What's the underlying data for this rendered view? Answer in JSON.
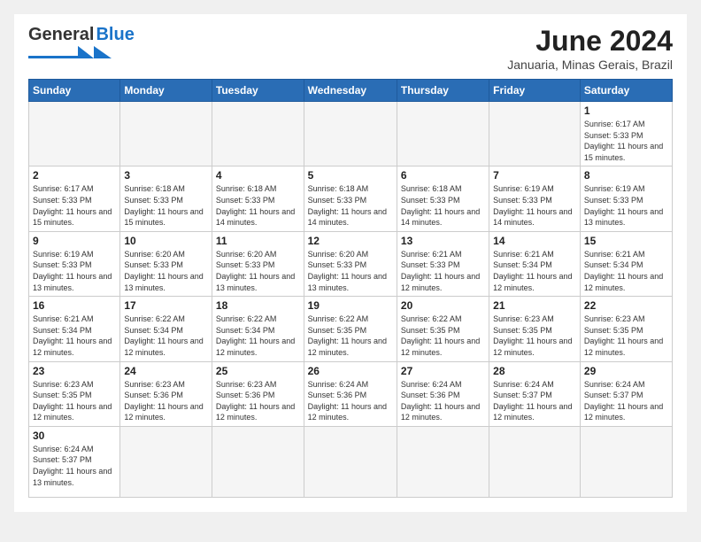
{
  "header": {
    "logo_general": "General",
    "logo_blue": "Blue",
    "month_title": "June 2024",
    "subtitle": "Januaria, Minas Gerais, Brazil"
  },
  "weekdays": [
    "Sunday",
    "Monday",
    "Tuesday",
    "Wednesday",
    "Thursday",
    "Friday",
    "Saturday"
  ],
  "weeks": [
    [
      {
        "day": "",
        "empty": true
      },
      {
        "day": "",
        "empty": true
      },
      {
        "day": "",
        "empty": true
      },
      {
        "day": "",
        "empty": true
      },
      {
        "day": "",
        "empty": true
      },
      {
        "day": "",
        "empty": true
      },
      {
        "day": "1",
        "sunrise": "Sunrise: 6:17 AM",
        "sunset": "Sunset: 5:33 PM",
        "daylight": "Daylight: 11 hours and 15 minutes."
      }
    ],
    [
      {
        "day": "2",
        "sunrise": "Sunrise: 6:17 AM",
        "sunset": "Sunset: 5:33 PM",
        "daylight": "Daylight: 11 hours and 15 minutes."
      },
      {
        "day": "3",
        "sunrise": "Sunrise: 6:18 AM",
        "sunset": "Sunset: 5:33 PM",
        "daylight": "Daylight: 11 hours and 15 minutes."
      },
      {
        "day": "4",
        "sunrise": "Sunrise: 6:18 AM",
        "sunset": "Sunset: 5:33 PM",
        "daylight": "Daylight: 11 hours and 14 minutes."
      },
      {
        "day": "5",
        "sunrise": "Sunrise: 6:18 AM",
        "sunset": "Sunset: 5:33 PM",
        "daylight": "Daylight: 11 hours and 14 minutes."
      },
      {
        "day": "6",
        "sunrise": "Sunrise: 6:18 AM",
        "sunset": "Sunset: 5:33 PM",
        "daylight": "Daylight: 11 hours and 14 minutes."
      },
      {
        "day": "7",
        "sunrise": "Sunrise: 6:19 AM",
        "sunset": "Sunset: 5:33 PM",
        "daylight": "Daylight: 11 hours and 14 minutes."
      },
      {
        "day": "8",
        "sunrise": "Sunrise: 6:19 AM",
        "sunset": "Sunset: 5:33 PM",
        "daylight": "Daylight: 11 hours and 13 minutes."
      }
    ],
    [
      {
        "day": "9",
        "sunrise": "Sunrise: 6:19 AM",
        "sunset": "Sunset: 5:33 PM",
        "daylight": "Daylight: 11 hours and 13 minutes."
      },
      {
        "day": "10",
        "sunrise": "Sunrise: 6:20 AM",
        "sunset": "Sunset: 5:33 PM",
        "daylight": "Daylight: 11 hours and 13 minutes."
      },
      {
        "day": "11",
        "sunrise": "Sunrise: 6:20 AM",
        "sunset": "Sunset: 5:33 PM",
        "daylight": "Daylight: 11 hours and 13 minutes."
      },
      {
        "day": "12",
        "sunrise": "Sunrise: 6:20 AM",
        "sunset": "Sunset: 5:33 PM",
        "daylight": "Daylight: 11 hours and 13 minutes."
      },
      {
        "day": "13",
        "sunrise": "Sunrise: 6:21 AM",
        "sunset": "Sunset: 5:33 PM",
        "daylight": "Daylight: 11 hours and 12 minutes."
      },
      {
        "day": "14",
        "sunrise": "Sunrise: 6:21 AM",
        "sunset": "Sunset: 5:34 PM",
        "daylight": "Daylight: 11 hours and 12 minutes."
      },
      {
        "day": "15",
        "sunrise": "Sunrise: 6:21 AM",
        "sunset": "Sunset: 5:34 PM",
        "daylight": "Daylight: 11 hours and 12 minutes."
      }
    ],
    [
      {
        "day": "16",
        "sunrise": "Sunrise: 6:21 AM",
        "sunset": "Sunset: 5:34 PM",
        "daylight": "Daylight: 11 hours and 12 minutes."
      },
      {
        "day": "17",
        "sunrise": "Sunrise: 6:22 AM",
        "sunset": "Sunset: 5:34 PM",
        "daylight": "Daylight: 11 hours and 12 minutes."
      },
      {
        "day": "18",
        "sunrise": "Sunrise: 6:22 AM",
        "sunset": "Sunset: 5:34 PM",
        "daylight": "Daylight: 11 hours and 12 minutes."
      },
      {
        "day": "19",
        "sunrise": "Sunrise: 6:22 AM",
        "sunset": "Sunset: 5:35 PM",
        "daylight": "Daylight: 11 hours and 12 minutes."
      },
      {
        "day": "20",
        "sunrise": "Sunrise: 6:22 AM",
        "sunset": "Sunset: 5:35 PM",
        "daylight": "Daylight: 11 hours and 12 minutes."
      },
      {
        "day": "21",
        "sunrise": "Sunrise: 6:23 AM",
        "sunset": "Sunset: 5:35 PM",
        "daylight": "Daylight: 11 hours and 12 minutes."
      },
      {
        "day": "22",
        "sunrise": "Sunrise: 6:23 AM",
        "sunset": "Sunset: 5:35 PM",
        "daylight": "Daylight: 11 hours and 12 minutes."
      }
    ],
    [
      {
        "day": "23",
        "sunrise": "Sunrise: 6:23 AM",
        "sunset": "Sunset: 5:35 PM",
        "daylight": "Daylight: 11 hours and 12 minutes."
      },
      {
        "day": "24",
        "sunrise": "Sunrise: 6:23 AM",
        "sunset": "Sunset: 5:36 PM",
        "daylight": "Daylight: 11 hours and 12 minutes."
      },
      {
        "day": "25",
        "sunrise": "Sunrise: 6:23 AM",
        "sunset": "Sunset: 5:36 PM",
        "daylight": "Daylight: 11 hours and 12 minutes."
      },
      {
        "day": "26",
        "sunrise": "Sunrise: 6:24 AM",
        "sunset": "Sunset: 5:36 PM",
        "daylight": "Daylight: 11 hours and 12 minutes."
      },
      {
        "day": "27",
        "sunrise": "Sunrise: 6:24 AM",
        "sunset": "Sunset: 5:36 PM",
        "daylight": "Daylight: 11 hours and 12 minutes."
      },
      {
        "day": "28",
        "sunrise": "Sunrise: 6:24 AM",
        "sunset": "Sunset: 5:37 PM",
        "daylight": "Daylight: 11 hours and 12 minutes."
      },
      {
        "day": "29",
        "sunrise": "Sunrise: 6:24 AM",
        "sunset": "Sunset: 5:37 PM",
        "daylight": "Daylight: 11 hours and 12 minutes."
      }
    ],
    [
      {
        "day": "30",
        "sunrise": "Sunrise: 6:24 AM",
        "sunset": "Sunset: 5:37 PM",
        "daylight": "Daylight: 11 hours and 13 minutes."
      },
      {
        "day": "",
        "empty": true
      },
      {
        "day": "",
        "empty": true
      },
      {
        "day": "",
        "empty": true
      },
      {
        "day": "",
        "empty": true
      },
      {
        "day": "",
        "empty": true
      },
      {
        "day": "",
        "empty": true
      }
    ]
  ]
}
